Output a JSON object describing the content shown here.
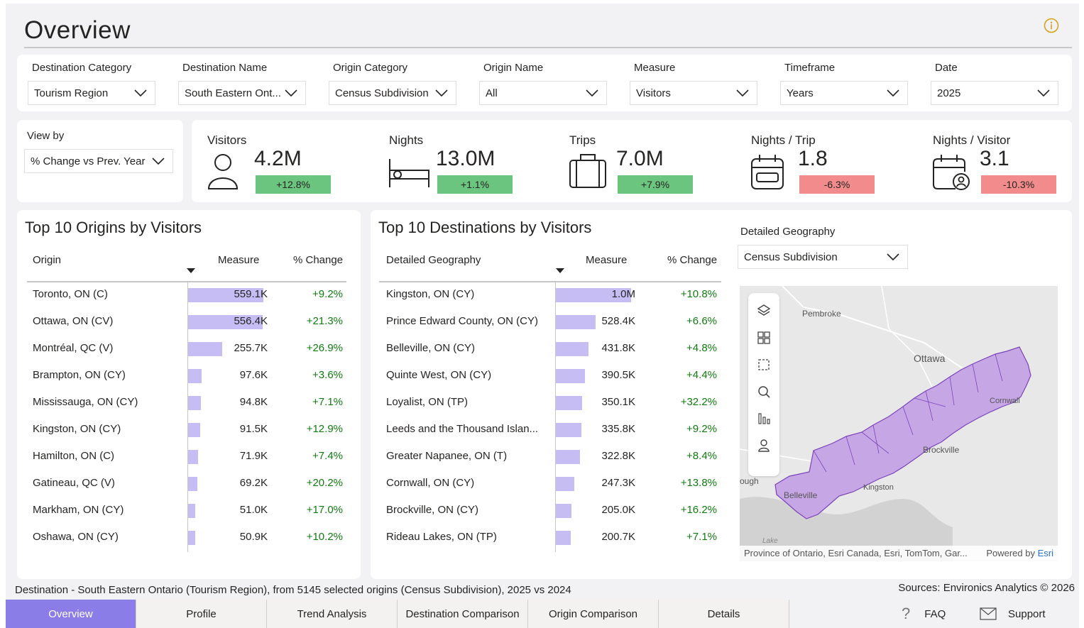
{
  "header": {
    "title": "Overview"
  },
  "filters": [
    {
      "label": "Destination Category",
      "value": "Tourism Region"
    },
    {
      "label": "Destination Name",
      "value": "South Eastern Ont..."
    },
    {
      "label": "Origin Category",
      "value": "Census Subdivision"
    },
    {
      "label": "Origin Name",
      "value": "All"
    },
    {
      "label": "Measure",
      "value": "Visitors"
    },
    {
      "label": "Timeframe",
      "value": "Years"
    },
    {
      "label": "Date",
      "value": "2025"
    }
  ],
  "view_by": {
    "label": "View by",
    "value": "% Change vs Prev. Year"
  },
  "kpis": [
    {
      "label": "Visitors",
      "value": "4.2M",
      "change": "+12.8%",
      "direction": "up",
      "icon": "person-icon"
    },
    {
      "label": "Nights",
      "value": "13.0M",
      "change": "+1.1%",
      "direction": "up",
      "icon": "bed-icon"
    },
    {
      "label": "Trips",
      "value": "7.0M",
      "change": "+7.9%",
      "direction": "up",
      "icon": "suitcase-icon"
    },
    {
      "label": "Nights / Trip",
      "value": "1.8",
      "change": "-6.3%",
      "direction": "down",
      "icon": "calendar-icon"
    },
    {
      "label": "Nights / Visitor",
      "value": "3.1",
      "change": "-10.3%",
      "direction": "down",
      "icon": "calendar-person-icon"
    }
  ],
  "colors": {
    "accent": "#8b7de8",
    "bar": "#c6bdf4",
    "positive": "#6cc57f",
    "negative": "#f28b8b",
    "positive_text": "#107c10",
    "map_fill": "#c7a6e6"
  },
  "origins_table": {
    "title": "Top 10 Origins by Visitors",
    "columns": [
      "Origin",
      "Measure",
      "% Change"
    ],
    "max_value": 559100,
    "rows": [
      {
        "name": "Toronto, ON (C)",
        "value": 559100,
        "label": "559.1K",
        "change": "+9.2%"
      },
      {
        "name": "Ottawa, ON (CV)",
        "value": 556400,
        "label": "556.4K",
        "change": "+21.3%"
      },
      {
        "name": "Montréal, QC (V)",
        "value": 255700,
        "label": "255.7K",
        "change": "+26.9%"
      },
      {
        "name": "Brampton, ON (CY)",
        "value": 97600,
        "label": "97.6K",
        "change": "+3.6%"
      },
      {
        "name": "Mississauga, ON (CY)",
        "value": 94800,
        "label": "94.8K",
        "change": "+7.1%"
      },
      {
        "name": "Kingston, ON (CY)",
        "value": 91500,
        "label": "91.5K",
        "change": "+12.9%"
      },
      {
        "name": "Hamilton, ON (C)",
        "value": 71900,
        "label": "71.9K",
        "change": "+7.4%"
      },
      {
        "name": "Gatineau, QC (V)",
        "value": 69200,
        "label": "69.2K",
        "change": "+20.2%"
      },
      {
        "name": "Markham, ON (CY)",
        "value": 51000,
        "label": "51.0K",
        "change": "+17.0%"
      },
      {
        "name": "Oshawa, ON (CY)",
        "value": 50900,
        "label": "50.9K",
        "change": "+10.2%"
      }
    ]
  },
  "destinations_table": {
    "title": "Top 10 Destinations by Visitors",
    "columns": [
      "Detailed Geography",
      "Measure",
      "% Change"
    ],
    "max_value": 1000000,
    "rows": [
      {
        "name": "Kingston, ON (CY)",
        "value": 1000000,
        "label": "1.0M",
        "change": "+10.8%"
      },
      {
        "name": "Prince Edward County, ON (CY)",
        "value": 528400,
        "label": "528.4K",
        "change": "+6.6%"
      },
      {
        "name": "Belleville, ON (CY)",
        "value": 431800,
        "label": "431.8K",
        "change": "+4.8%"
      },
      {
        "name": "Quinte West, ON (CY)",
        "value": 390500,
        "label": "390.5K",
        "change": "+4.4%"
      },
      {
        "name": "Loyalist, ON (TP)",
        "value": 350100,
        "label": "350.1K",
        "change": "+32.2%"
      },
      {
        "name": "Leeds and the Thousand Islan...",
        "value": 335800,
        "label": "335.8K",
        "change": "+9.2%"
      },
      {
        "name": "Greater Napanee, ON (T)",
        "value": 322800,
        "label": "322.8K",
        "change": "+8.4%"
      },
      {
        "name": "Cornwall, ON (CY)",
        "value": 247300,
        "label": "247.3K",
        "change": "+13.8%"
      },
      {
        "name": "Brockville, ON (CY)",
        "value": 205000,
        "label": "205.0K",
        "change": "+16.2%"
      },
      {
        "name": "Rideau Lakes, ON (TP)",
        "value": 200700,
        "label": "200.7K",
        "change": "+7.1%"
      }
    ]
  },
  "map": {
    "geo_label": "Detailed Geography",
    "geo_value": "Census Subdivision",
    "places": [
      "Pembroke",
      "Ottawa",
      "Cornwall",
      "Brockville",
      "Kingston",
      "Belleville",
      "ough",
      "Lake"
    ],
    "attribution": "Province of Ontario, Esri Canada, Esri, TomTom, Gar...",
    "powered_by": "Powered by",
    "powered_brand": "Esri",
    "tools": [
      "layers-icon",
      "qr-select-icon",
      "rect-select-icon",
      "search-icon",
      "bar-chart-icon",
      "person-locate-icon"
    ]
  },
  "footer": {
    "description": "Destination - South Eastern Ontario (Tourism Region), from 5145 selected origins (Census Subdivision), 2025 vs 2024",
    "sources": "Sources: Environics Analytics © 2026"
  },
  "tabs": [
    "Overview",
    "Profile",
    "Trend Analysis",
    "Destination Comparison",
    "Origin Comparison",
    "Details"
  ],
  "tab_actions": {
    "faq": "FAQ",
    "support": "Support"
  }
}
